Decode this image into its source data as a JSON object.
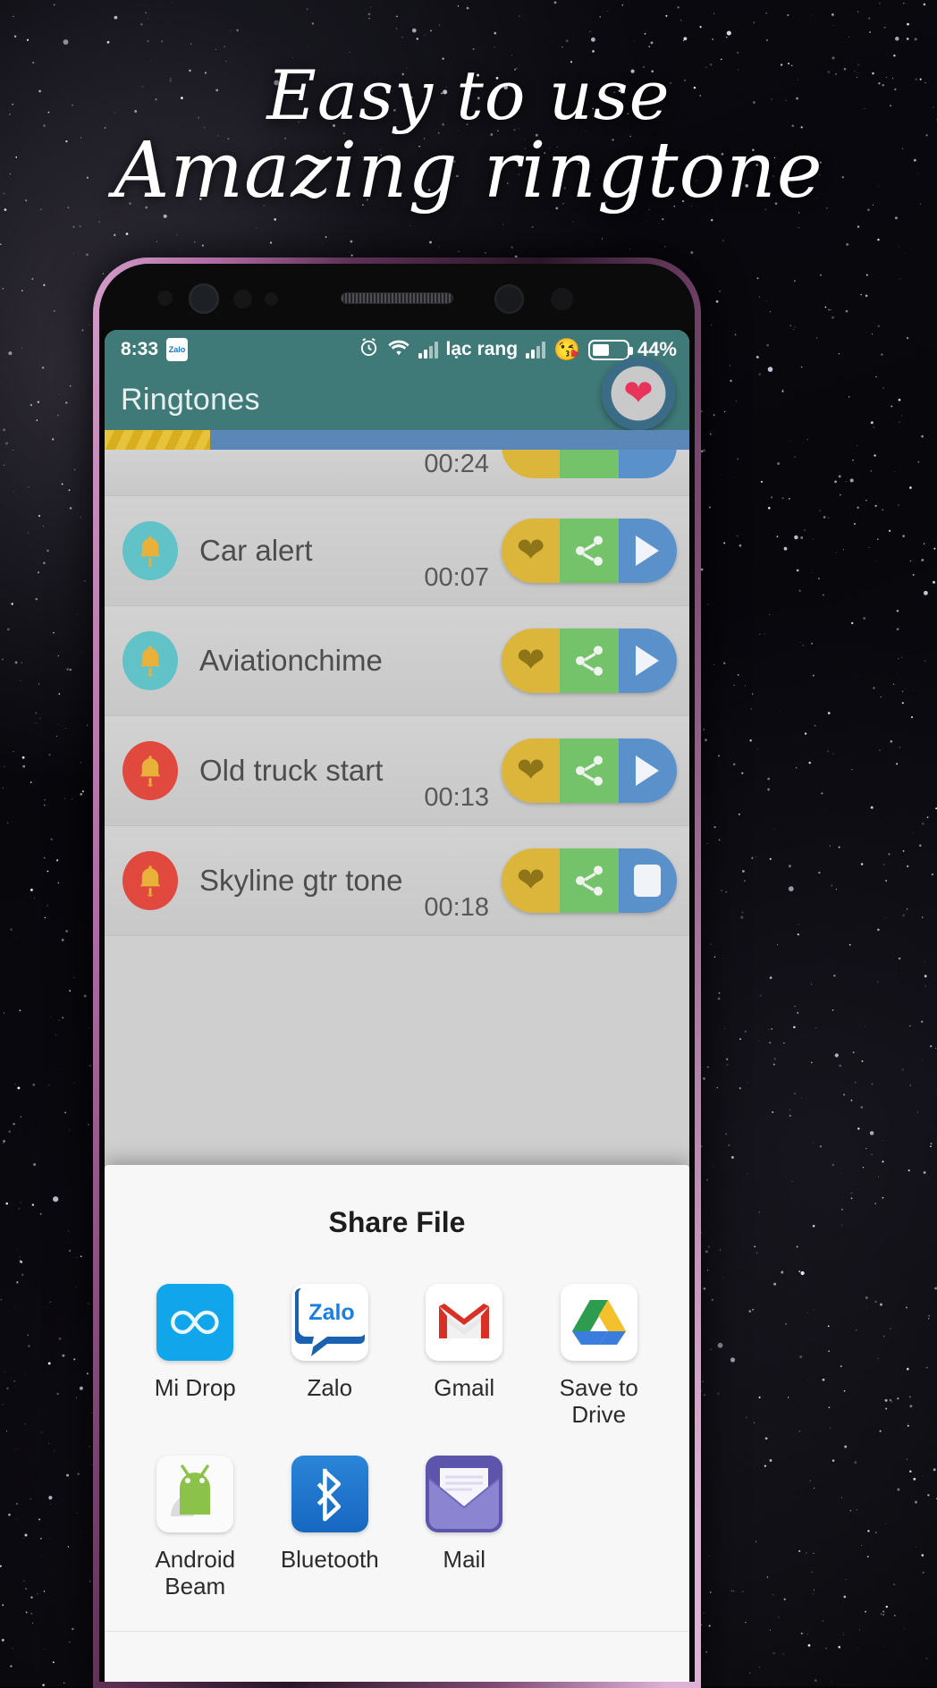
{
  "promo": {
    "line1": "Easy to use",
    "line2": "Amazing ringtone"
  },
  "phone": {
    "status_bar": {
      "time": "8:33",
      "zalo_badge": "Zalo",
      "alarm_icon": "alarm-clock-icon",
      "wifi_icon": "wifi-icon",
      "signal_icon": "signal-bars-icon",
      "carrier": "lạc rang",
      "signal2_icon": "signal-bars-icon",
      "emoji_icon": "smiling-face-with-hearts-emoji",
      "battery_icon": "battery-icon",
      "battery_percent": "44%",
      "battery_level": 44
    },
    "toolbar": {
      "title": "Ringtones",
      "favorites_fab_icon": "heart-icon"
    },
    "accent_teal": "#3f7a78",
    "strip": {
      "bar_color": "#5b86b8",
      "hatch_color": "#dcb63a"
    }
  },
  "list": {
    "action_labels": {
      "favorite": "favorite-button",
      "share": "share-button",
      "play": "play-button",
      "stop": "stop-button"
    },
    "items": [
      {
        "title": "",
        "duration": "00:24",
        "bell_color": "teal",
        "playing": false,
        "partial": true
      },
      {
        "title": "Car alert",
        "duration": "00:07",
        "bell_color": "teal",
        "playing": false,
        "partial": false
      },
      {
        "title": "Aviationchime",
        "duration": "",
        "bell_color": "teal",
        "playing": false,
        "partial": false
      },
      {
        "title": "Old truck start",
        "duration": "00:13",
        "bell_color": "red",
        "playing": false,
        "partial": false
      },
      {
        "title": "Skyline gtr tone",
        "duration": "00:18",
        "bell_color": "red",
        "playing": true,
        "partial": false
      }
    ]
  },
  "share_sheet": {
    "title": "Share File",
    "apps": [
      {
        "label": "Mi Drop",
        "icon": "mi-drop-icon"
      },
      {
        "label": "Zalo",
        "icon": "zalo-icon"
      },
      {
        "label": "Gmail",
        "icon": "gmail-icon"
      },
      {
        "label": "Save to Drive",
        "icon": "google-drive-icon"
      },
      {
        "label": "Android Beam",
        "icon": "android-beam-icon"
      },
      {
        "label": "Bluetooth",
        "icon": "bluetooth-icon"
      },
      {
        "label": "Mail",
        "icon": "mail-envelope-icon"
      }
    ]
  },
  "colors": {
    "toolbar_teal": "#3f7a78",
    "favorite_yellow": "#dcb63a",
    "share_green": "#74c36a",
    "play_blue": "#5b91cb",
    "bell_teal": "#61c3c8",
    "bell_red": "#e1483e",
    "heart_red": "#e8345a"
  }
}
